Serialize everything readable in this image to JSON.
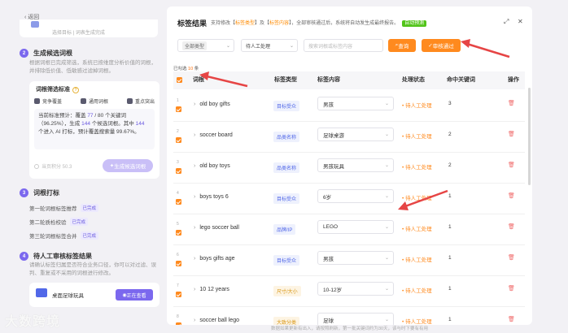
{
  "left": {
    "back_label": "返回",
    "prev_card_text": "选择目标 | 词表生成完成",
    "step2": {
      "num": "2",
      "title": "生成候选词根",
      "desc": "根据词根已完成筛选，系统已按维度分析价值的词根，并排除低价值、低敏感过滤掉词根。"
    },
    "std_box": {
      "title": "词根筛选标准",
      "options": [
        "竞争覆盖",
        "通用词根",
        "重点突出"
      ],
      "text_a": "当前标准预计：覆盖 ",
      "covered": "77",
      "text_b": " / 80 个关键词（96.25%），生成 ",
      "generated": "144",
      "text_c": " 个候选词根。其中 ",
      "ai_count": "144",
      "text_d": " 个进入 AI 打标，预计覆盖搜索量 99.67%。",
      "bottom_note": "当页积分 50.3",
      "gen_button": "生成候选词根"
    },
    "step3": {
      "num": "3",
      "title": "词根打标",
      "items": [
        {
          "label": "第一轮词根标签推荐",
          "badge": "已完成"
        },
        {
          "label": "第二轮质检校验",
          "badge": "已完成"
        },
        {
          "label": "第三轮词根标签合并",
          "badge": "已完成"
        }
      ]
    },
    "step4": {
      "num": "4",
      "title": "待人工审核标签结果",
      "desc": "请确认标签归属是否符合业务口径，你可以对过滤、误判、重复或不采用的词根进行修改。"
    },
    "review_card": {
      "name": "桌面足球玩具",
      "button": "正在查看"
    },
    "watermark": "大数跨境"
  },
  "right": {
    "title": "标签结果",
    "subtitle_a": "支持修改【",
    "subtitle_b": "标签类型",
    "subtitle_c": "】及【",
    "subtitle_d": "标签内容",
    "subtitle_e": "】，全部审核通过后，系统将自动发生成最终报告。",
    "subtitle_tag": "自动预测",
    "filters": {
      "type_chip": "全部类型",
      "status": "待人工处理",
      "search_placeholder": "搜索词根或标签内容",
      "query_button": "查询",
      "approve_button": "审核通过"
    },
    "selected_prefix": "已勾选",
    "selected_count": "10",
    "selected_suffix": "条",
    "headers": {
      "keyword": "词根",
      "type": "标签类型",
      "content": "标签内容",
      "status": "处理状态",
      "hits": "命中关键词",
      "ops": "操作"
    },
    "rows": [
      {
        "idx": "1",
        "keyword": "old boy gifts",
        "type": "目标受众",
        "type_color": "#5168e8",
        "type_bg": "#eef1fd",
        "content": "男孩",
        "status": "待人工处理",
        "hits": "3"
      },
      {
        "idx": "2",
        "keyword": "soccer board",
        "type": "品类名称",
        "type_color": "#5168e8",
        "type_bg": "#eef1fd",
        "content": "足球桌游",
        "status": "待人工处理",
        "hits": "2"
      },
      {
        "idx": "3",
        "keyword": "old boy toys",
        "type": "品类名称",
        "type_color": "#5168e8",
        "type_bg": "#eef1fd",
        "content": "男孩玩具",
        "status": "待人工处理",
        "hits": "2"
      },
      {
        "idx": "4",
        "keyword": "boys toys 6",
        "type": "目标受众",
        "type_color": "#5168e8",
        "type_bg": "#eef1fd",
        "content": "6岁",
        "status": "待人工处理",
        "hits": "1"
      },
      {
        "idx": "5",
        "keyword": "lego soccer ball",
        "type": "品牌/IP",
        "type_color": "#5168e8",
        "type_bg": "#eef1fd",
        "content": "LEGO",
        "status": "待人工处理",
        "hits": "1"
      },
      {
        "idx": "6",
        "keyword": "boys gifts age",
        "type": "目标受众",
        "type_color": "#5168e8",
        "type_bg": "#eef1fd",
        "content": "男孩",
        "status": "待人工处理",
        "hits": "1"
      },
      {
        "idx": "7",
        "keyword": "10 12 years",
        "type": "尺寸/大小",
        "type_color": "#d89614",
        "type_bg": "#fdf4e3",
        "content": "10-12岁",
        "status": "待人工处理",
        "hits": "1"
      },
      {
        "idx": "8",
        "keyword": "soccer ball lego",
        "type": "大致分类",
        "type_color": "#d89614",
        "type_bg": "#fdf4e3",
        "content": "足球",
        "status": "待人工处理",
        "hits": "1"
      }
    ],
    "footer": "数据如果更新有出入，请按照刷新，第一批关键词约为30天，该与时下要有有用"
  },
  "colors": {
    "accent": "#7b68ee",
    "orange": "#ff8a1e",
    "arrow": "#e64545"
  }
}
